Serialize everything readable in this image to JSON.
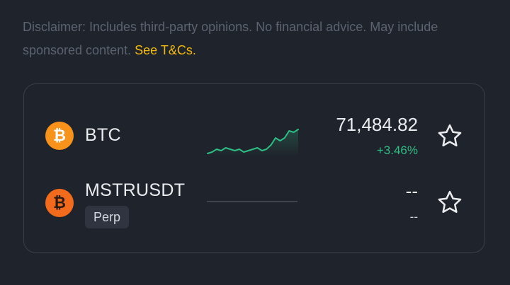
{
  "disclaimer": {
    "text": "Disclaimer: Includes third-party opinions. No financial advice. May include sponsored content.",
    "link": "See T&Cs."
  },
  "rows": [
    {
      "symbol": "BTC",
      "icon": "bitcoin-icon",
      "price": "71,484.82",
      "change": "+3.46%",
      "change_color": "#2ebd85",
      "sparkline": [
        3,
        4,
        6,
        5,
        7,
        6,
        5,
        6,
        4,
        5,
        6,
        7,
        5,
        6,
        9,
        14,
        12,
        14,
        19,
        18,
        20
      ]
    },
    {
      "symbol": "MSTRUSDT",
      "badge": "Perp",
      "icon": "bitcoin-icon",
      "price": "--",
      "change": "--"
    }
  ],
  "colors": {
    "accent_link": "#f0b90b",
    "positive": "#2ebd85",
    "btc_orange": "#f7931a"
  }
}
